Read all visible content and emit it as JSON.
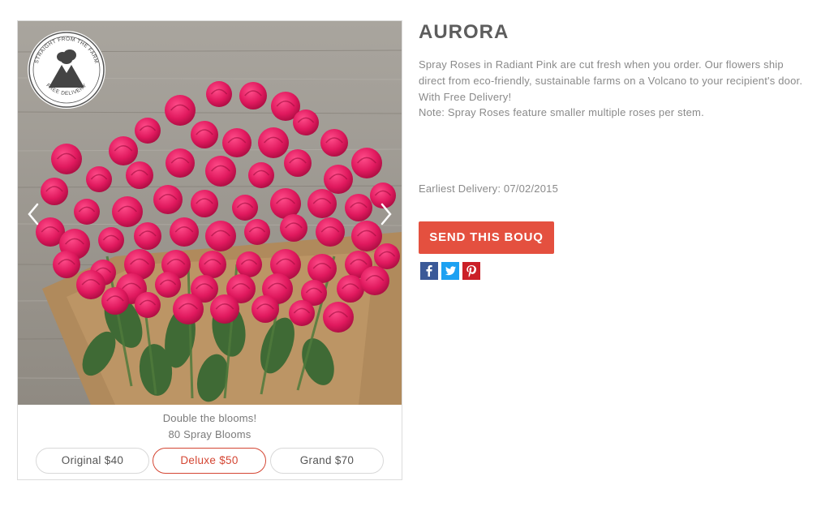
{
  "product": {
    "title": "AURORA",
    "description": "Spray Roses in Radiant Pink are cut fresh when you order. Our flowers ship direct from eco-friendly, sustainable farms on a Volcano to your recipient's door. With Free Delivery!",
    "note": "Note: Spray Roses feature smaller multiple roses per stem.",
    "earliest_delivery": "Earliest Delivery: 07/02/2015",
    "send_button_label": "SEND THIS BOUQ"
  },
  "badge": {
    "top_text": "STRAIGHT FROM THE FARM",
    "bottom_text": "FREE DELIVERY",
    "icon": "volcano-icon"
  },
  "gallery": {
    "caption_line1": "Double the blooms!",
    "caption_line2": "80 Spray Blooms",
    "prev_icon": "chevron-left-icon",
    "next_icon": "chevron-right-icon"
  },
  "sizes": [
    {
      "label": "Original $40",
      "selected": false
    },
    {
      "label": "Deluxe $50",
      "selected": true
    },
    {
      "label": "Grand $70",
      "selected": false
    }
  ],
  "social": [
    {
      "name": "facebook-icon",
      "color": "#3b5998"
    },
    {
      "name": "twitter-icon",
      "color": "#1da1f2"
    },
    {
      "name": "pinterest-icon",
      "color": "#cb2027"
    }
  ],
  "colors": {
    "accent": "#e4503f",
    "selected_border": "#d44633",
    "rose_pink": "#e0195e",
    "wood": "#9e9a93",
    "kraft_paper": "#b08a5c"
  }
}
